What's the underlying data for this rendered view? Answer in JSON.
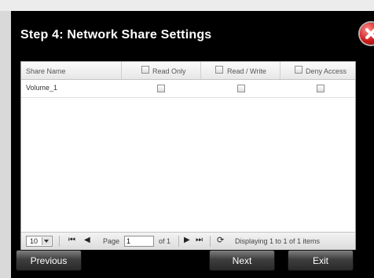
{
  "dialog": {
    "title": "Step 4: Network Share Settings"
  },
  "table": {
    "headers": {
      "share_name": "Share Name",
      "read_only": "Read Only",
      "read_write": "Read / Write",
      "deny_access": "Deny Access"
    },
    "rows": [
      {
        "name": "Volume_1"
      }
    ]
  },
  "pager": {
    "page_size": "10",
    "page_label": "Page",
    "page_value": "1",
    "of_label": "of 1",
    "status": "Displaying 1 to 1 of 1 items"
  },
  "buttons": {
    "previous": "Previous",
    "next": "Next",
    "exit": "Exit"
  }
}
